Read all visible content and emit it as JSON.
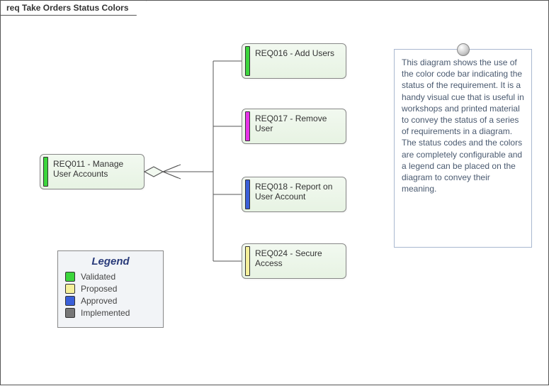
{
  "frameTitle": "req Take Orders Status Colors",
  "parent": {
    "label": "REQ011 - Manage User Accounts",
    "status": "validated"
  },
  "children": [
    {
      "label": "REQ016 - Add Users",
      "status": "validated"
    },
    {
      "label": "REQ017 - Remove User",
      "status": "magenta"
    },
    {
      "label": "REQ018 - Report on User Account",
      "status": "approved"
    },
    {
      "label": "REQ024 - Secure Access",
      "status": "proposed"
    }
  ],
  "legend": {
    "title": "Legend",
    "items": [
      {
        "label": "Validated",
        "status": "validated"
      },
      {
        "label": "Proposed",
        "status": "proposed"
      },
      {
        "label": "Approved",
        "status": "approved"
      },
      {
        "label": "Implemented",
        "status": "implemented"
      }
    ]
  },
  "note": "This diagram shows the use of the color code bar indicating the status of the requirement. It is a handy visual cue that is useful in workshops and printed material to convey the status of a series of requirements in a diagram. The status codes and the colors are completely configurable and a legend can be placed on the diagram to convey their meaning."
}
